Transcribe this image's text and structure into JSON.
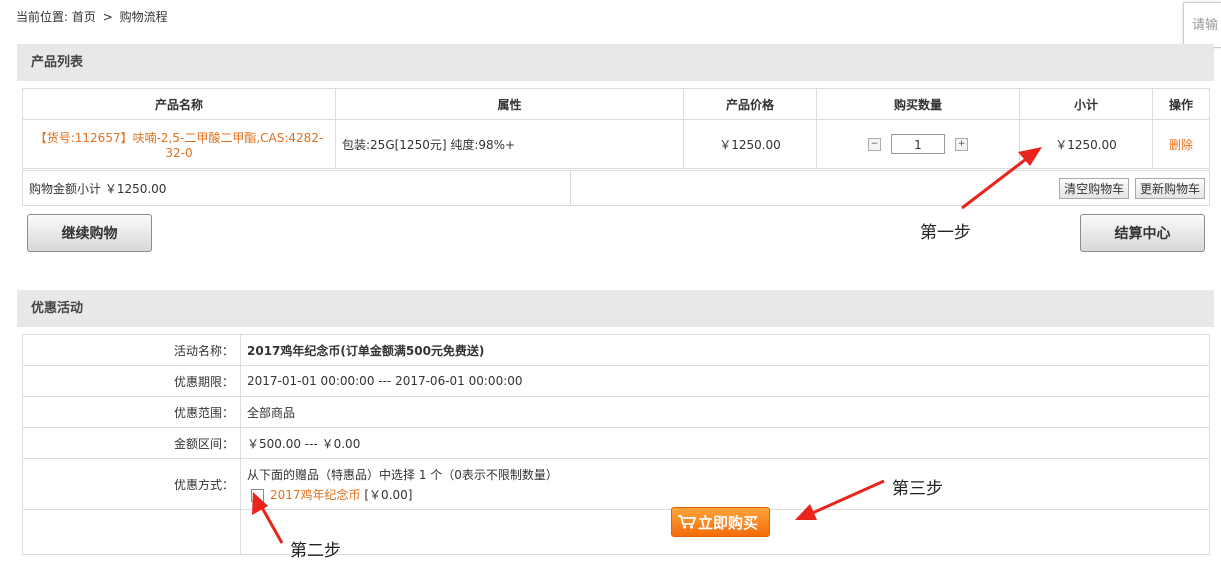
{
  "breadcrumb": {
    "prefix": "当前位置:",
    "home": "首页",
    "sep": ">",
    "current": "购物流程"
  },
  "side_input": {
    "placeholder": "请输"
  },
  "cart": {
    "section_title": "产品列表",
    "headers": [
      "产品名称",
      "属性",
      "产品价格",
      "购买数量",
      "小计",
      "操作"
    ],
    "row": {
      "name": "【货号:112657】呋喃-2,5-二甲酸二甲酯,CAS:4282-32-0",
      "attribute": "包装:25G[1250元] 纯度:98%+",
      "price": "￥1250.00",
      "quantity": "1",
      "qty_minus": "−",
      "qty_plus": "+",
      "subtotal": "￥1250.00",
      "delete": "删除"
    },
    "summary": "购物金额小计 ￥1250.00",
    "clear_button": "清空购物车",
    "update_button": "更新购物车",
    "continue_button": "继续购物",
    "checkout_button": "结算中心"
  },
  "promo": {
    "section_title": "优惠活动",
    "rows": [
      {
        "label": "活动名称：",
        "value": "2017鸡年纪念币(订单金额满500元免费送)"
      },
      {
        "label": "优惠期限：",
        "value": "2017-01-01 00:00:00 --- 2017-06-01 00:00:00"
      },
      {
        "label": "优惠范围：",
        "value": "全部商品"
      },
      {
        "label": "金额区间：",
        "value": "￥500.00 --- ￥0.00"
      }
    ],
    "method_label": "优惠方式：",
    "method_text": "从下面的赠品（特惠品）中选择 1 个（0表示不限制数量）",
    "gift_name": "2017鸡年纪念币",
    "gift_price": "[￥0.00]",
    "buy_button": "立即购买"
  },
  "annotations": {
    "step1": "第一步",
    "step2": "第二步",
    "step3": "第三步"
  },
  "colors": {
    "accent": "#e0701e",
    "arrow": "#e8241c",
    "section_bg": "#e8e8e8"
  }
}
